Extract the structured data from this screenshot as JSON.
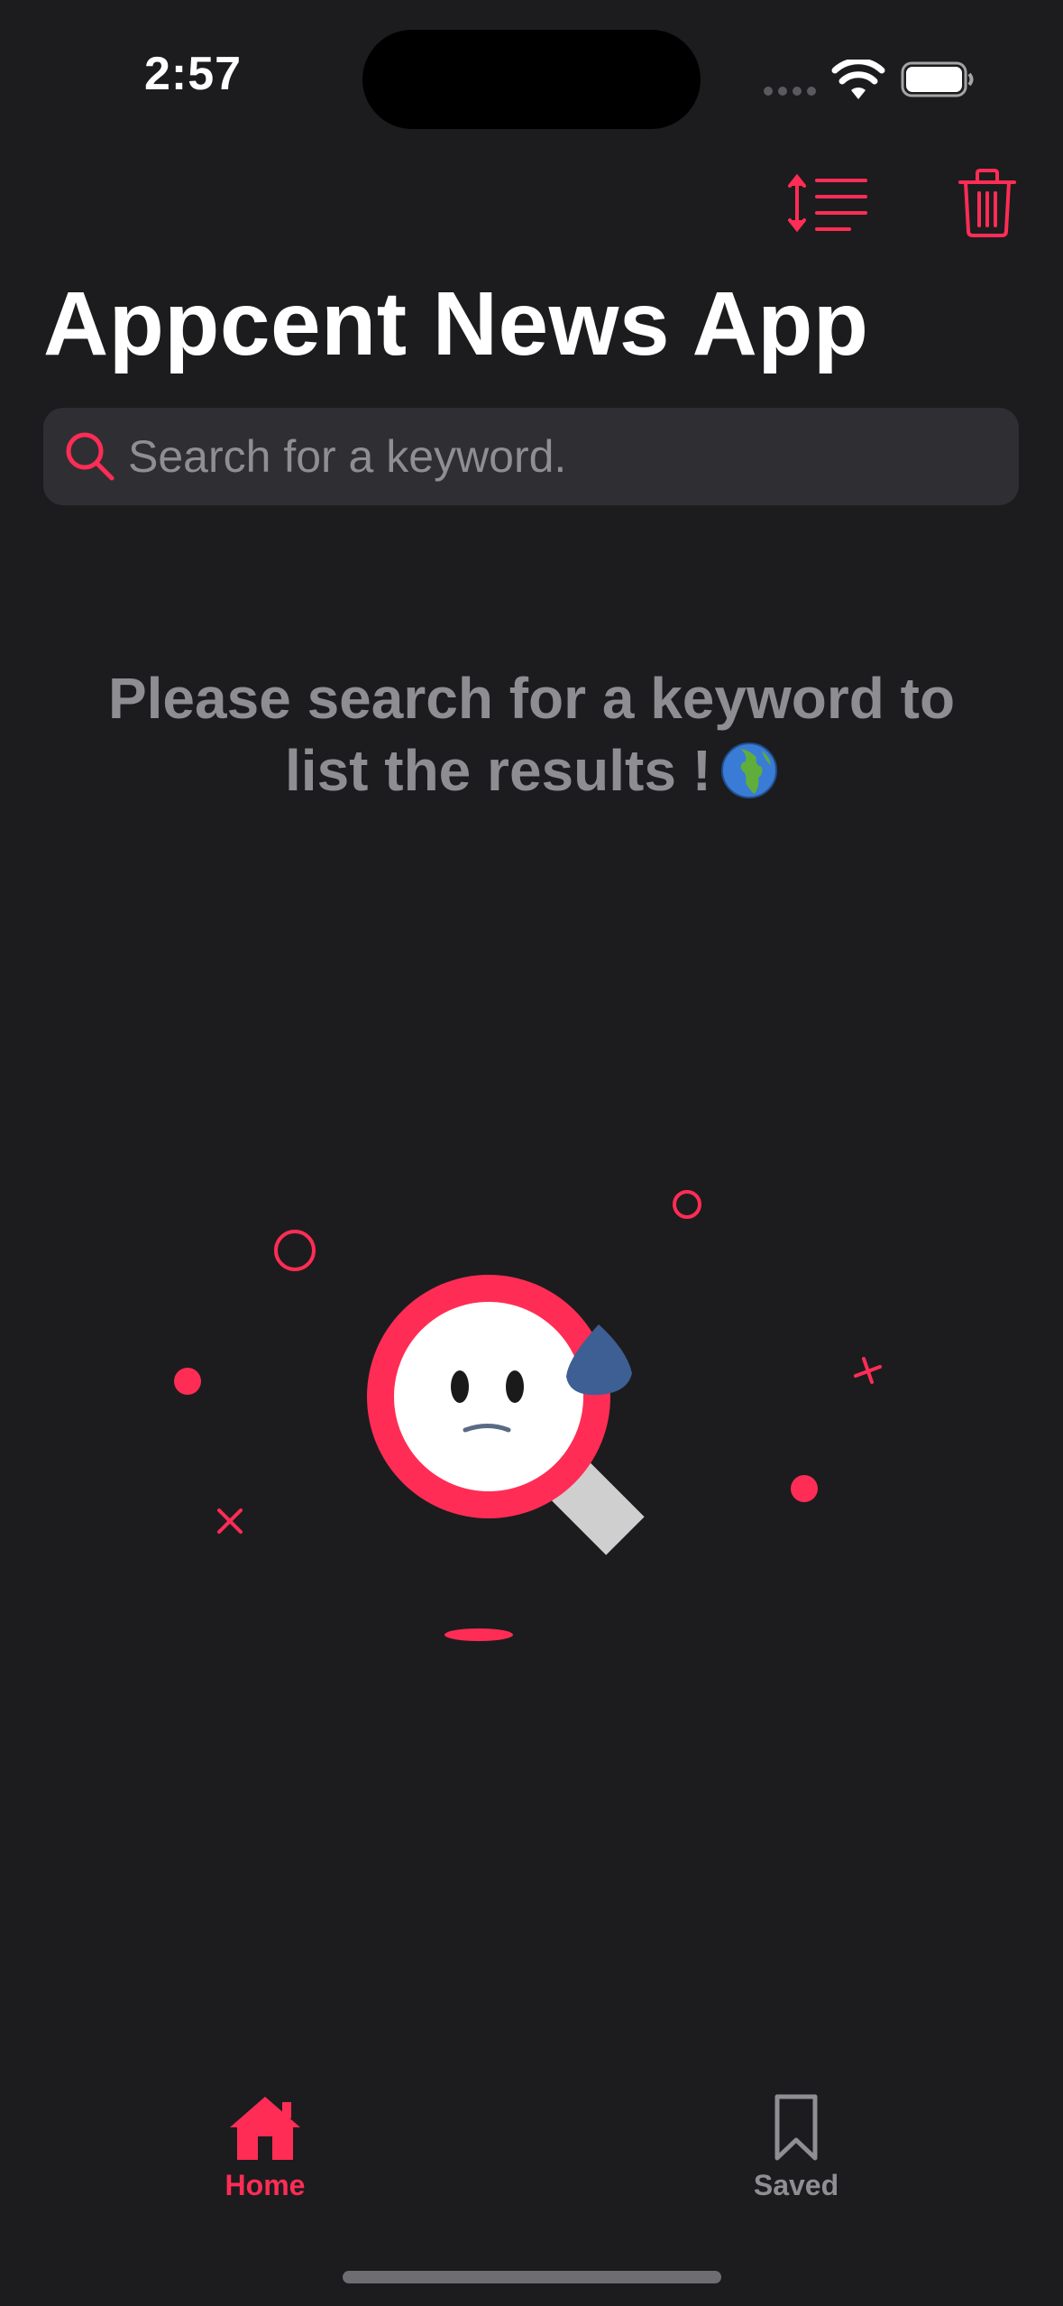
{
  "status_bar": {
    "time": "2:57"
  },
  "toolbar": {
    "sort_icon": "sort-list-icon",
    "trash_icon": "trash-icon"
  },
  "title": "Appcent News App",
  "search": {
    "placeholder": "Search for a keyword.",
    "value": ""
  },
  "empty_state": {
    "message": "Please search for a keyword to list the results !",
    "emoji": "globe-icon",
    "illustration": "sad-magnifier-icon"
  },
  "tabs": [
    {
      "label": "Home",
      "icon": "home-icon",
      "selected": true
    },
    {
      "label": "Saved",
      "icon": "bookmark-icon",
      "selected": false
    }
  ],
  "colors": {
    "accent": "#ff2d55",
    "background": "#1c1c1e",
    "search_bg": "#2f2f33",
    "muted_text": "#8d8d92"
  }
}
